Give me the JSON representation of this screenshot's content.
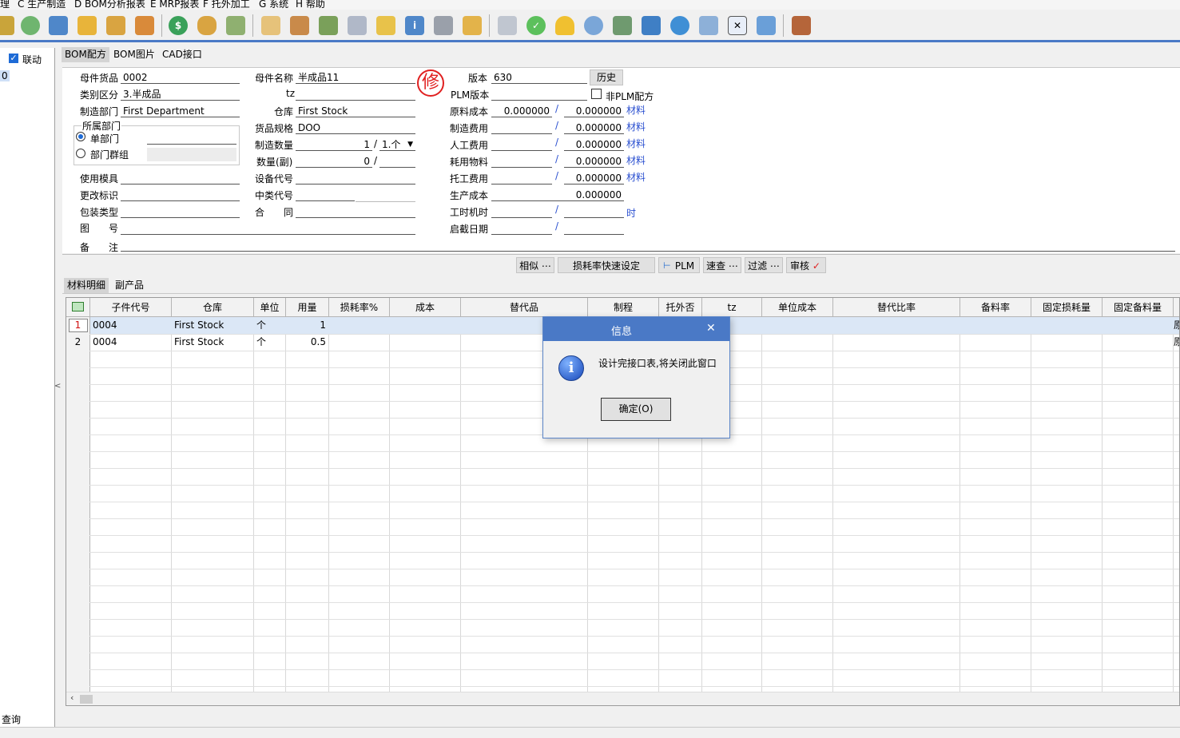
{
  "menu": [
    "理",
    "C 生产制造",
    "D BOM分析报表",
    "E MRP报表",
    "F 托外加工",
    "G 系统",
    "H 帮助"
  ],
  "toolbar": {
    "icons": [
      "link-icon",
      "phone-icon",
      "computer-icon",
      "lock-icon",
      "briefcase-icon",
      "home-icon",
      "dollar-icon",
      "money-bag-icon",
      "cart-icon",
      "clipboard-icon",
      "users-icon",
      "tools-icon",
      "help-doc-icon",
      "mail-icon",
      "info-icon",
      "calculator-icon",
      "folder-icon",
      "document-icon",
      "check-circle-icon",
      "bell-icon",
      "search-icon",
      "org-chart-icon",
      "monitor-icon",
      "refresh-icon",
      "windows-icon",
      "close-window-icon",
      "restore-window-icon",
      "exit-door-icon"
    ]
  },
  "left": {
    "link_label": "联动",
    "value": "0",
    "query_label": "查询",
    "collapse_glyph": "<"
  },
  "tabs": [
    "BOM配方",
    "BOM图片",
    "CAD接口"
  ],
  "form": {
    "parent_item_label": "母件货品",
    "parent_item": "0002",
    "category_label": "类别区分",
    "category": "3.半成品",
    "dept_label": "制造部门",
    "dept": "First Department",
    "owner_dept_label": "所属部门",
    "single_dept_label": "单部门",
    "dept_group_label": "部门群组",
    "mold_label": "使用模具",
    "change_label": "更改标识",
    "pack_label": "包装类型",
    "drawing_label": "图　　号",
    "remark_label": "备　　注",
    "parent_name_label": "母件名称",
    "parent_name": "半成品11",
    "tz_label": "tz",
    "warehouse_label": "仓库",
    "warehouse": "First Stock",
    "spec_label": "货品规格",
    "spec": "DOO",
    "qty_label": "制造数量",
    "qty": "1",
    "qty_unit": "1.个",
    "qty2_label": "数量(副)",
    "qty2": "0",
    "equip_label": "设备代号",
    "midclass_label": "中类代号",
    "contract_label": "合　　同",
    "stamp_char": "修",
    "version_label": "版本",
    "version": "630",
    "history_label": "历史",
    "plm_version_label": "PLM版本",
    "non_plm_label": "非PLM配方",
    "raw_cost_label": "原料成本",
    "raw_cost_a": "0.000000",
    "raw_cost_b": "0.000000",
    "mfg_cost_label": "制造费用",
    "mfg_cost_b": "0.000000",
    "labor_cost_label": "人工费用",
    "labor_cost_b": "0.000000",
    "consumable_label": "耗用物料",
    "consumable_b": "0.000000",
    "outsource_label": "托工费用",
    "outsource_b": "0.000000",
    "prod_cost_label": "生产成本",
    "prod_cost": "0.000000",
    "hours_label": "工时机时",
    "effective_label": "启截日期",
    "material_tag": "材料",
    "hour_tag": "时"
  },
  "action_buttons": [
    "相似 ⋯",
    "损耗率快速设定",
    "PLM",
    "速查 ⋯",
    "过滤 ⋯",
    "审核"
  ],
  "subtabs": [
    "材料明细",
    "副产品"
  ],
  "grid": {
    "columns": [
      "子件代号",
      "仓库",
      "单位",
      "用量",
      "损耗率%",
      "成本",
      "替代品",
      "制程",
      "托外否",
      "tz",
      "单位成本",
      "替代比率",
      "备料率",
      "固定损耗量",
      "固定备料量"
    ],
    "rows": [
      {
        "n": "1",
        "code": "0004",
        "wh": "First Stock",
        "unit": "个",
        "qty": "1",
        "tail": "原"
      },
      {
        "n": "2",
        "code": "0004",
        "wh": "First Stock",
        "unit": "个",
        "qty": "0.5",
        "tail": "原"
      }
    ]
  },
  "dialog": {
    "title": "信息",
    "message": "设计完接口表,将关闭此窗口",
    "ok_label": "确定(O)"
  }
}
